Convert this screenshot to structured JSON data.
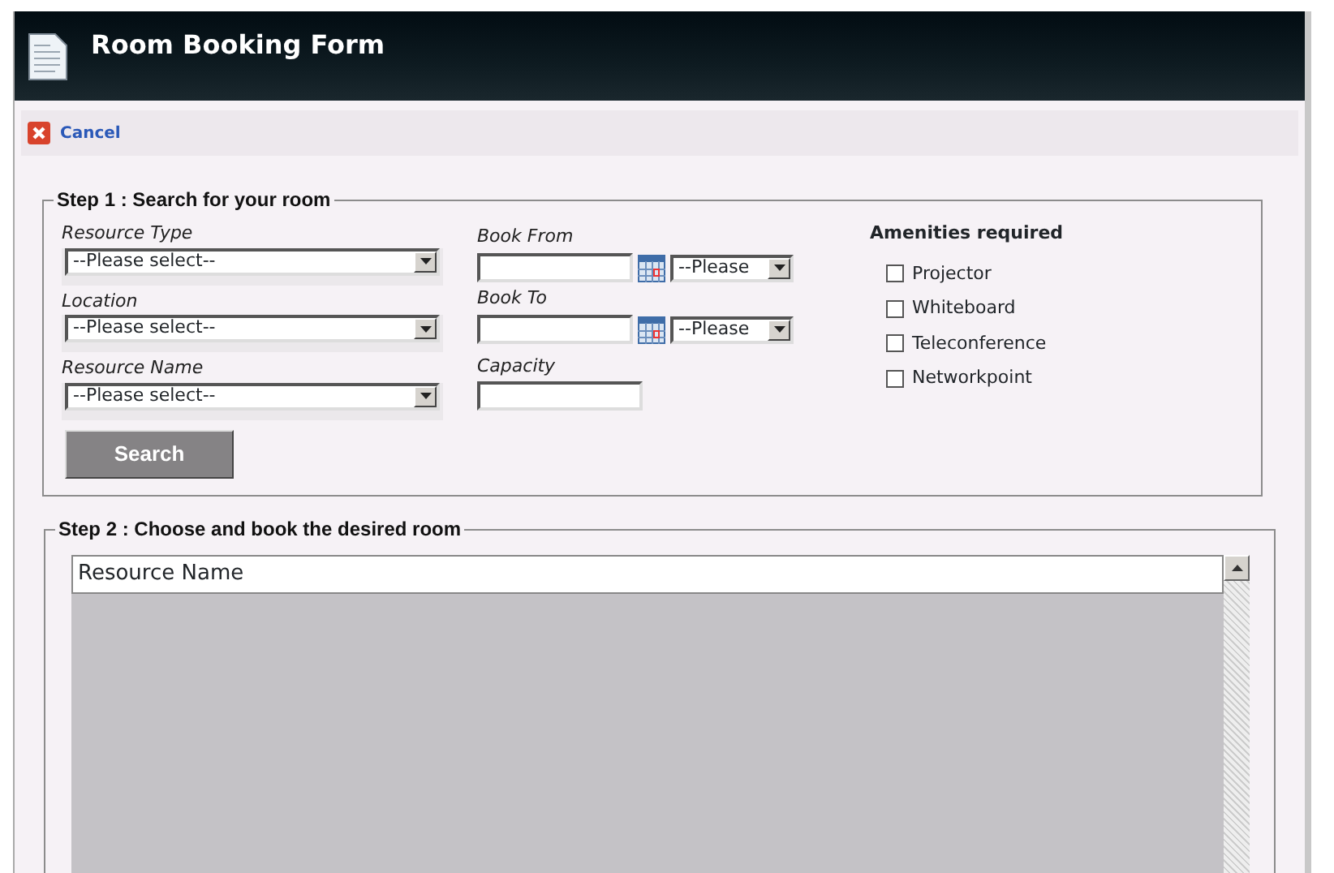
{
  "window": {
    "title": "Room Booking Form"
  },
  "toolbar": {
    "cancel": "Cancel"
  },
  "step1": {
    "legend": "Step 1 : Search for your room",
    "selects": [
      {
        "label": "Resource Type",
        "value": "--Please select--"
      },
      {
        "label": "Location",
        "value": "--Please select--"
      },
      {
        "label": "Resource Name",
        "value": "--Please select--"
      }
    ],
    "dates": [
      {
        "label": "Book From",
        "time": "--Please"
      },
      {
        "label": "Book To",
        "time": "--Please"
      }
    ],
    "capacity": {
      "label": "Capacity"
    },
    "search_button": "Search",
    "amenities": {
      "title": "Amenities required",
      "items": [
        {
          "label": "Projector",
          "checked": false
        },
        {
          "label": "Whiteboard",
          "checked": false
        },
        {
          "label": "Teleconference",
          "checked": false
        },
        {
          "label": "Networkpoint",
          "checked": false
        }
      ]
    }
  },
  "step2": {
    "legend": "Step 2 : Choose and book the desired room",
    "table": {
      "columns": [
        "Resource Name"
      ]
    }
  }
}
